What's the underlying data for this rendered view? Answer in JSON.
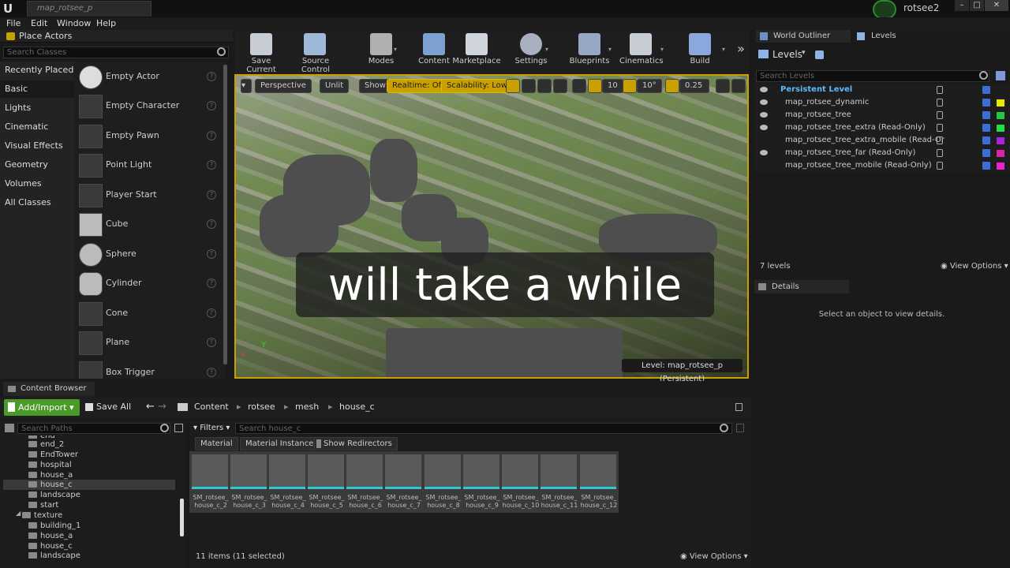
{
  "titlebar": {
    "doc_tab": "map_rotsee_p",
    "project_name": "rotsee2",
    "logo": "U"
  },
  "menus": [
    "File",
    "Edit",
    "Window",
    "Help"
  ],
  "place_actors": {
    "tab": "Place Actors",
    "search_placeholder": "Search Classes",
    "categories": [
      "Recently Placed",
      "Basic",
      "Lights",
      "Cinematic",
      "Visual Effects",
      "Geometry",
      "Volumes",
      "All Classes"
    ],
    "selected_category": "Basic",
    "actors": [
      "Empty Actor",
      "Empty Character",
      "Empty Pawn",
      "Point Light",
      "Player Start",
      "Cube",
      "Sphere",
      "Cylinder",
      "Cone",
      "Plane",
      "Box Trigger"
    ],
    "help_glyph": "?"
  },
  "toolbar": {
    "buttons": [
      "Save Current",
      "Source Control",
      "Modes",
      "Content",
      "Marketplace",
      "Settings",
      "Blueprints",
      "Cinematics",
      "Build"
    ],
    "more": "»"
  },
  "viewport": {
    "perspective": "Perspective",
    "lit": "Unlit",
    "show": "Show",
    "realtime": "Realtime: Off",
    "scalability": "Scalability: Low",
    "grid_snap": "10",
    "rot_snap": "10°",
    "scale_snap": "0.25",
    "level_label": "Level:  map_rotsee_p (Persistent)",
    "caption": "will take a while",
    "axis_x": "x",
    "axis_y": "Y"
  },
  "outliner": {
    "tabs": [
      "World Outliner",
      "Levels"
    ],
    "title": "Levels",
    "search_placeholder": "Search Levels",
    "levels": [
      {
        "name": "Persistent Level",
        "color": ""
      },
      {
        "name": "map_rotsee_dynamic",
        "color": "#e8e800"
      },
      {
        "name": "map_rotsee_tree",
        "color": "#22c84a"
      },
      {
        "name": "map_rotsee_tree_extra (Read-Only)",
        "color": "#22dd44"
      },
      {
        "name": "map_rotsee_tree_extra_mobile (Read-Or",
        "color": "#aa22dd"
      },
      {
        "name": "map_rotsee_tree_far (Read-Only)",
        "color": "#dd22aa"
      },
      {
        "name": "map_rotsee_tree_mobile (Read-Only)",
        "color": "#ee22cc"
      }
    ],
    "count": "7 levels",
    "view_options": "View Options"
  },
  "details": {
    "tab": "Details",
    "empty_text": "Select an object to view details."
  },
  "content_browser": {
    "tab": "Content Browser",
    "add_import": "Add/Import",
    "save_all": "Save All",
    "breadcrumb": [
      "Content",
      "rotsee",
      "mesh",
      "house_c"
    ],
    "search_paths_placeholder": "Search Paths",
    "folders": [
      "end",
      "end_2",
      "EndTower",
      "hospital",
      "house_a",
      "house_c",
      "landscape",
      "start",
      "texture",
      "building_1",
      "house_a",
      "house_c",
      "landscape"
    ],
    "filters_label": "Filters",
    "search_assets_placeholder": "Search house_c",
    "filter_chips": [
      "Material",
      "Material Instance",
      "Show Redirectors"
    ],
    "assets": [
      [
        "SM_rotsee_",
        "house_c_2"
      ],
      [
        "SM_rotsee_",
        "house_c_3"
      ],
      [
        "SM_rotsee_",
        "house_c_4"
      ],
      [
        "SM_rotsee_",
        "house_c_5"
      ],
      [
        "SM_rotsee_",
        "house_c_6"
      ],
      [
        "SM_rotsee_",
        "house_c_7"
      ],
      [
        "SM_rotsee_",
        "house_c_8"
      ],
      [
        "SM_rotsee_",
        "house_c_9"
      ],
      [
        "SM_rotsee_",
        "house_c_10"
      ],
      [
        "SM_rotsee_",
        "house_c_11"
      ],
      [
        "SM_rotsee_",
        "house_c_12"
      ]
    ],
    "item_count": "11 items (11 selected)",
    "view_options": "View Options"
  }
}
